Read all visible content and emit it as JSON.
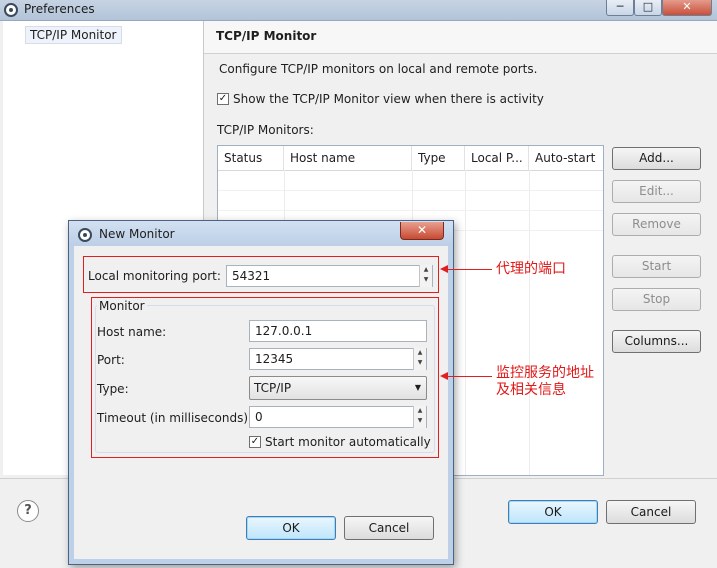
{
  "preferences": {
    "window_title": "Preferences",
    "caption_buttons": {
      "minimize": "─",
      "maximize": "□",
      "close": "✕"
    },
    "tree": {
      "selected_item": "TCP/IP Monitor"
    },
    "page_title": "TCP/IP Monitor",
    "description": "Configure TCP/IP monitors on local and remote ports.",
    "show_view_checkbox": {
      "label": "Show the TCP/IP Monitor view when there is activity",
      "checked": true,
      "mark": "✓"
    },
    "monitors_label": "TCP/IP Monitors:",
    "table": {
      "columns": [
        "Status",
        "Host name",
        "Type",
        "Local P...",
        "Auto-start"
      ],
      "rows": []
    },
    "side_buttons": {
      "add": "Add...",
      "edit": "Edit...",
      "remove": "Remove",
      "start": "Start",
      "stop": "Stop",
      "columns": "Columns..."
    },
    "help_icon_glyph": "?",
    "ok": "OK",
    "cancel": "Cancel"
  },
  "new_monitor_dialog": {
    "title": "New Monitor",
    "close_glyph": "✕",
    "local_port_label": "Local monitoring port:",
    "local_port_value": "54321",
    "monitor_group_label": "Monitor",
    "host_name_label": "Host name:",
    "host_name_value": "127.0.0.1",
    "port_label": "Port:",
    "port_value": "12345",
    "type_label": "Type:",
    "type_value": "TCP/IP",
    "timeout_label": "Timeout (in milliseconds):",
    "timeout_value": "0",
    "start_auto_label": "Start monitor automatically",
    "start_auto_checked": true,
    "check_mark": "✓",
    "ok": "OK",
    "cancel": "Cancel",
    "spin_up": "▲",
    "spin_down": "▼",
    "dropdown_arrow": "▼"
  },
  "annotations": {
    "proxy_port": "代理的端口",
    "monitored_service_line1": "监控服务的地址",
    "monitored_service_line2": "及相关信息"
  },
  "colors": {
    "annotation_red": "#e01818",
    "titlebar_blue": "#bccfe7",
    "default_button_blue": "#bee6fd"
  },
  "icons": [
    "app-icon",
    "help-icon",
    "close-icon",
    "spin-up-icon",
    "spin-down-icon",
    "dropdown-arrow-icon",
    "checkbox-icon"
  ]
}
